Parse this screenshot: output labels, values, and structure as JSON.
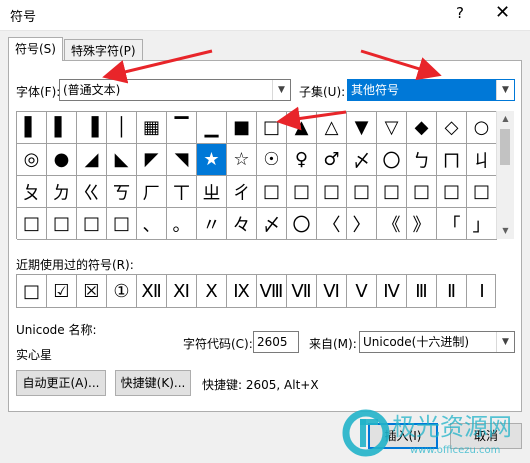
{
  "window": {
    "title": "符号",
    "help_glyph": "?",
    "close_glyph": "✕"
  },
  "tabs": [
    {
      "label": "符号(S)"
    },
    {
      "label": "特殊字符(P)"
    }
  ],
  "font": {
    "label": "字体(F):",
    "value": "(普通文本)"
  },
  "subset": {
    "label": "子集(U):",
    "value": "其他符号"
  },
  "symbols": [
    "▌",
    "▌",
    "▐",
    "│",
    "▦",
    "▔",
    "▁",
    "■",
    "□",
    "▲",
    "△",
    "▼",
    "▽",
    "◆",
    "◇",
    "○",
    "◎",
    "●",
    "◢",
    "◣",
    "◤",
    "◥",
    "★",
    "☆",
    "☉",
    "♀",
    "♂",
    "〆",
    "〇",
    "ㄅ",
    "ㄇ",
    "ㄐ",
    "ㄆ",
    "ㄉ",
    "ㄍ",
    "ㄎ",
    "ㄏ",
    "ㄒ",
    "ㄓ",
    "ㄔ",
    "□",
    "□",
    "□",
    "□",
    "□",
    "□",
    "□",
    "□",
    "□",
    "□",
    "□",
    "□",
    "、",
    "。",
    "〃",
    "々",
    "〆",
    "〇",
    "〈",
    "〉",
    "《",
    "》",
    "「",
    "」"
  ],
  "recent": {
    "label": "近期使用过的符号(R):",
    "items": [
      "□",
      "☑",
      "☒",
      "①",
      "Ⅻ",
      "Ⅺ",
      "Ⅹ",
      "Ⅸ",
      "Ⅷ",
      "Ⅶ",
      "Ⅵ",
      "Ⅴ",
      "Ⅳ",
      "Ⅲ",
      "Ⅱ",
      "Ⅰ"
    ]
  },
  "unicode_name": {
    "label": "Unicode 名称:",
    "value": "实心星"
  },
  "char_code": {
    "label": "字符代码(C):",
    "value": "2605"
  },
  "from": {
    "label": "来自(M):",
    "value": "Unicode(十六进制)"
  },
  "buttons": {
    "autocorrect": "自动更正(A)...",
    "shortcut": "快捷键(K)...",
    "insert": "插入(I)",
    "cancel": "取消"
  },
  "shortcut_info": "快捷键: 2605, Alt+X",
  "watermark": {
    "text": "极光资源网",
    "url": "www.officezu.com"
  },
  "colors": {
    "accent": "#0078d7",
    "annotation_arrow": "#e8252a",
    "watermark": "#21b3c9"
  }
}
